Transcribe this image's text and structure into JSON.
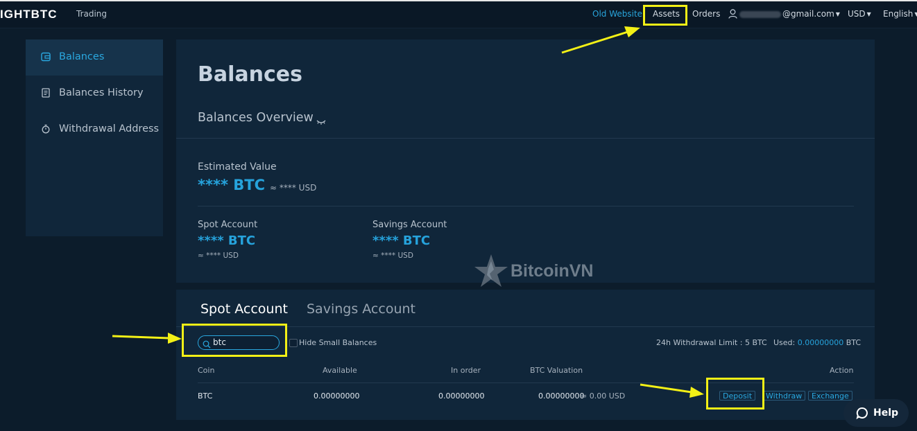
{
  "nav": {
    "logo": "IGHTBTC",
    "trading": "Trading",
    "old_website": "Old Website",
    "assets": "Assets",
    "orders": "Orders",
    "email_suffix": "@gmail.com",
    "currency": "USD",
    "language": "English"
  },
  "sidebar": {
    "items": [
      {
        "label": "Balances",
        "icon": "wallet-icon"
      },
      {
        "label": "Balances History",
        "icon": "document-icon"
      },
      {
        "label": "Withdrawal Address",
        "icon": "timer-icon"
      }
    ]
  },
  "overview": {
    "title": "Balances",
    "subtitle": "Balances Overview",
    "estimated_label": "Estimated Value",
    "estimated_value": "**** BTC",
    "estimated_usd": "≈ **** USD",
    "spot": {
      "label": "Spot Account",
      "value": "**** BTC",
      "usd": "≈ **** USD"
    },
    "savings": {
      "label": "Savings Account",
      "value": "**** BTC",
      "usd": "≈ **** USD"
    }
  },
  "watermark": "BitcoinVN",
  "tabs": {
    "spot": "Spot Account",
    "savings": "Savings Account"
  },
  "filters": {
    "search_value": "btc",
    "hide_small": "Hide Small Balances"
  },
  "limits": {
    "withdrawal_limit": "24h Withdrawal Limit :  5 BTC",
    "used_label": "Used: ",
    "used_value": "0.00000000",
    "used_unit": " BTC"
  },
  "table": {
    "headers": {
      "coin": "Coin",
      "available": "Available",
      "in_order": "In order",
      "btc_valuation": "BTC Valuation",
      "action": "Action"
    },
    "rows": [
      {
        "coin": "BTC",
        "available": "0.00000000",
        "in_order": "0.00000000",
        "btc_valuation": "0.00000000",
        "usd_approx": "≈ 0.00 USD",
        "actions": [
          "Deposit",
          "Withdraw",
          "Exchange"
        ]
      }
    ]
  },
  "help": "Help",
  "colors": {
    "accent": "#2aa8e0",
    "highlight": "#f3f016",
    "background": "#0c1c2b",
    "panel": "#10263a"
  }
}
